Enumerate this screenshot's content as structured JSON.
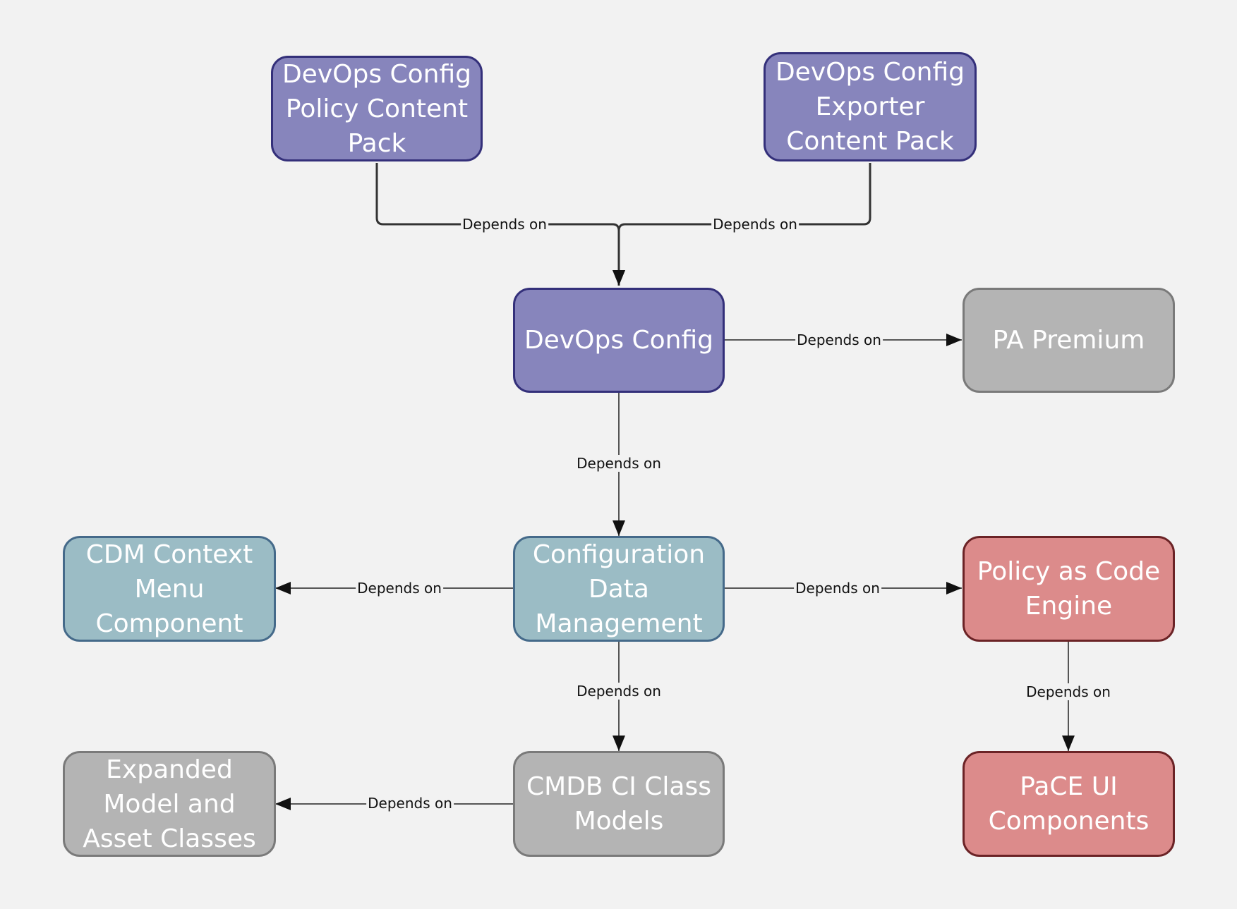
{
  "nodes": {
    "policy_pack": "DevOps Config Policy Content Pack",
    "exporter_pack": "DevOps Config Exporter Content Pack",
    "devops_config": "DevOps Config",
    "pa_premium": "PA Premium",
    "cdm_menu": "CDM Context Menu Component",
    "config_data_mgmt": "Configuration Data Management",
    "policy_engine": "Policy as Code Engine",
    "expanded_model": "Expanded Model and Asset Classes",
    "cmdb_models": "CMDB CI Class Models",
    "pace_ui": "PaCE UI Components"
  },
  "edges": {
    "e1": "Depends on",
    "e2": "Depends on",
    "e3": "Depends on",
    "e4": "Depends on",
    "e5": "Depends on",
    "e6": "Depends on",
    "e7": "Depends on",
    "e8": "Depends on",
    "e9": "Depends on"
  },
  "colors": {
    "purple_fill": "#8785bc",
    "gray_fill": "#b4b4b4",
    "teal_fill": "#9bbcc5",
    "red_fill": "#dc8b8b",
    "edge": "#222222"
  }
}
